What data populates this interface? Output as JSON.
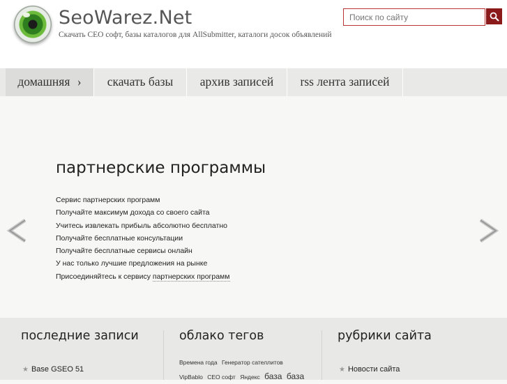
{
  "header": {
    "site_title": "SeoWarez.Net",
    "site_description": "Скачать СЕО софт, базы каталогов для AllSubmitter, каталоги досок объявлений",
    "logo_icon": "eye-logo-icon"
  },
  "search": {
    "placeholder": "Поиск по сайту",
    "button_icon": "search-icon"
  },
  "nav": {
    "items": [
      {
        "label": "домашняя",
        "chevron": "›"
      },
      {
        "label": "скачать базы"
      },
      {
        "label": "архив записей"
      },
      {
        "label": "rss лента записей"
      }
    ]
  },
  "slider": {
    "title": "партнерские программы",
    "lines": [
      "Сервис партнерских программ",
      "Получайте максимум дохода со своего сайта",
      "Учитесь извлекать прибыль абсолютно бесплатно",
      "Получайте бесплатные консультации",
      "Получайте бесплатные сервисы онлайн",
      "У нас только лучшие предложения на рынке"
    ],
    "last_line_prefix": "Присоединяйтесь к сервису ",
    "last_line_link": "партнерских программ",
    "prev_icon": "chevron-left-icon",
    "next_icon": "chevron-right-icon"
  },
  "footer": {
    "recent": {
      "title": "последние записи",
      "items": [
        "Base GSEO 51"
      ]
    },
    "tags": {
      "title": "облако тегов",
      "items": [
        {
          "label": "Времена года",
          "size": "small"
        },
        {
          "label": "Генератор сателлитов",
          "size": "small"
        },
        {
          "label": "VipBablo",
          "size": "small"
        },
        {
          "label": "СЕО софт",
          "size": "small"
        },
        {
          "label": "Яндекс",
          "size": "small"
        },
        {
          "label": "база",
          "size": "big"
        },
        {
          "label": "база",
          "size": "big"
        }
      ]
    },
    "categories": {
      "title": "рубрики сайта",
      "items": [
        "Новости сайта"
      ]
    }
  }
}
